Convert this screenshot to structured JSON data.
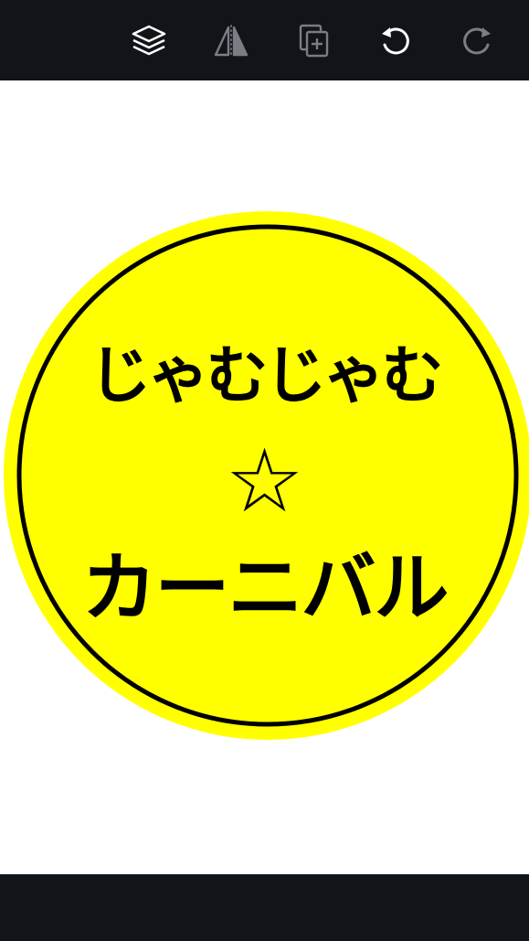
{
  "toolbar": {
    "icons": [
      "layers-icon",
      "flip-icon",
      "duplicate-icon",
      "undo-icon",
      "redo-icon"
    ],
    "icon_color": "#ffffff",
    "disabled_icon_color": "#7a7d83",
    "background": "#111419"
  },
  "sticker": {
    "line1": "じゃむじゃむ",
    "star": "☆",
    "line2": "カーニバル",
    "fill_color": "#ffff00",
    "ring_color": "#000000",
    "text_color": "#000000"
  }
}
